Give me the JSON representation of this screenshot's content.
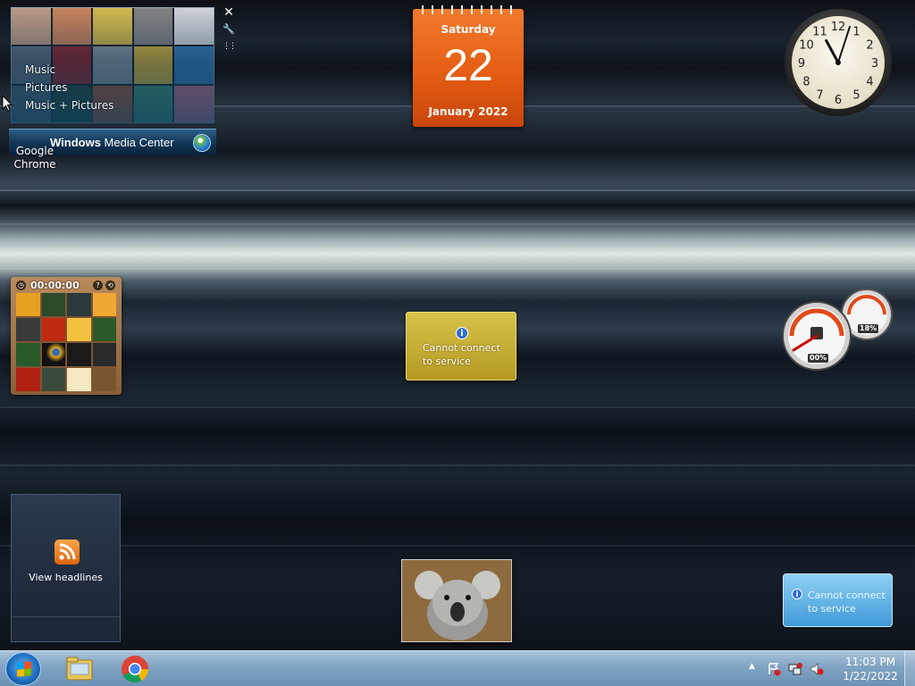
{
  "desktop": {
    "chrome_label": "Google Chrome"
  },
  "media_center": {
    "menu": [
      "Music",
      "Pictures",
      "Music + Pictures"
    ],
    "title_bold": "Windows",
    "title_rest": " Media Center"
  },
  "gadget_controls": {
    "close": "✕",
    "options": "🔧",
    "drag": "⋮⋮"
  },
  "calendar": {
    "day": "Saturday",
    "date": "22",
    "month": "January 2022"
  },
  "clock_gadget": {
    "hour": 11,
    "minute": 3,
    "numbers": [
      "12",
      "1",
      "2",
      "3",
      "4",
      "5",
      "6",
      "7",
      "8",
      "9",
      "10",
      "11"
    ]
  },
  "puzzle": {
    "time": "00:00:00"
  },
  "weather": {
    "message": "Cannot connect to service"
  },
  "cpu_meter": {
    "cpu_percent": "00%",
    "memory_percent": "18%"
  },
  "feeds": {
    "text": "View headlines"
  },
  "currency": {
    "message": "Cannot connect to service"
  },
  "taskbar": {
    "time": "11:03 PM",
    "date": "1/22/2022",
    "tray_arrow": "▲"
  },
  "colors": {
    "calendar": "#e45d14",
    "weather": "#c8b030",
    "currency": "#6ab8e8",
    "taskbar": "#7fa3c2"
  }
}
